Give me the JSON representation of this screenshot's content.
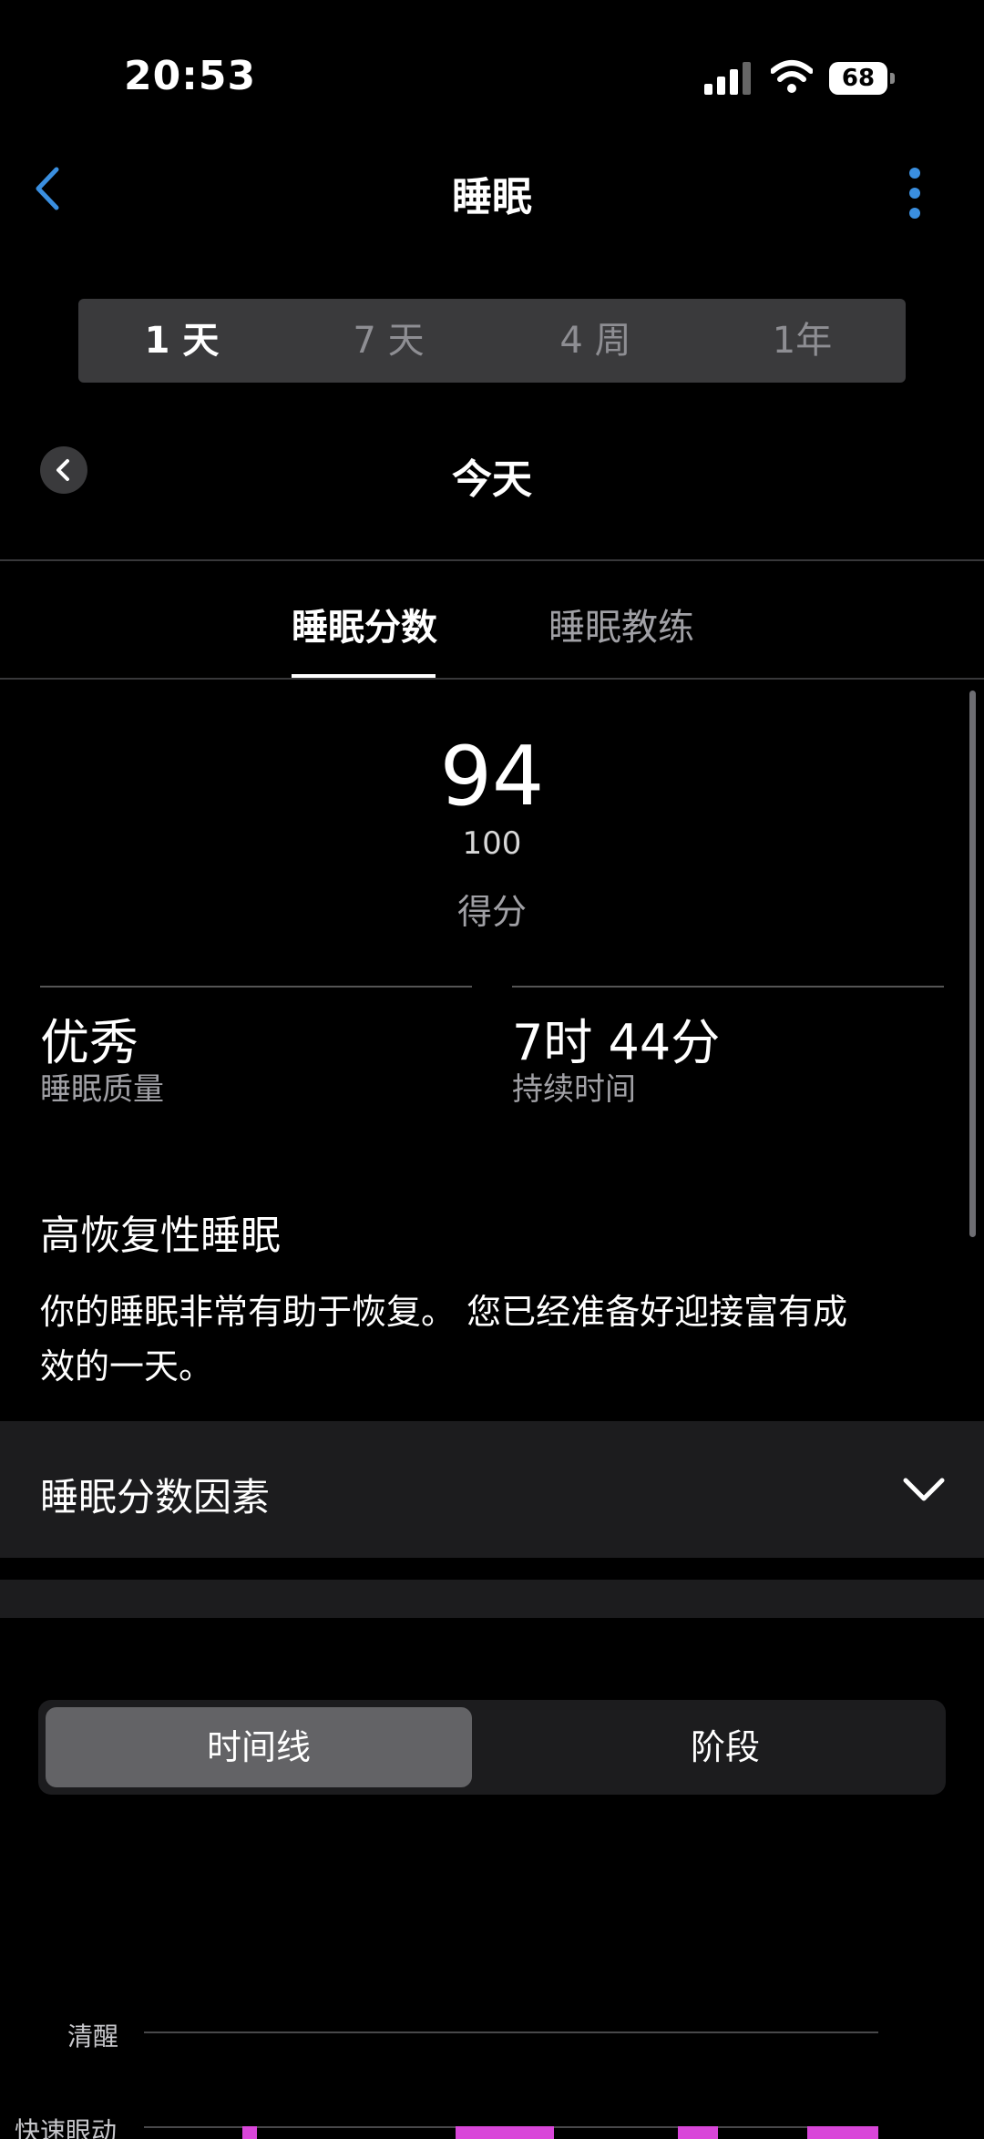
{
  "status_bar": {
    "time": "20:53",
    "battery": "68"
  },
  "nav": {
    "title": "睡眠"
  },
  "period_tabs": [
    {
      "label": "1 天",
      "active": true
    },
    {
      "label": "7 天",
      "active": false
    },
    {
      "label": "4 周",
      "active": false
    },
    {
      "label": "1年",
      "active": false
    }
  ],
  "date": {
    "title": "今天"
  },
  "content_tabs": {
    "score": "睡眠分数",
    "coach": "睡眠教练"
  },
  "score": {
    "value": "94",
    "max": "100",
    "label": "得分"
  },
  "stats": {
    "quality_value": "优秀",
    "quality_label": "睡眠质量",
    "duration_value": "7时 44分",
    "duration_label": "持续时间"
  },
  "summary": {
    "headline": "高恢复性睡眠",
    "description": "你的睡眠非常有助于恢复。 您已经准备好迎接富有成效的一天。"
  },
  "factors": {
    "label": "睡眠分数因素"
  },
  "view_toggle": {
    "timeline": "时间线",
    "stages": "阶段",
    "active": "timeline"
  },
  "chart": {
    "awake_label": "清醒",
    "rem_label": "快速眼动",
    "rem_color": "#d946d9"
  }
}
